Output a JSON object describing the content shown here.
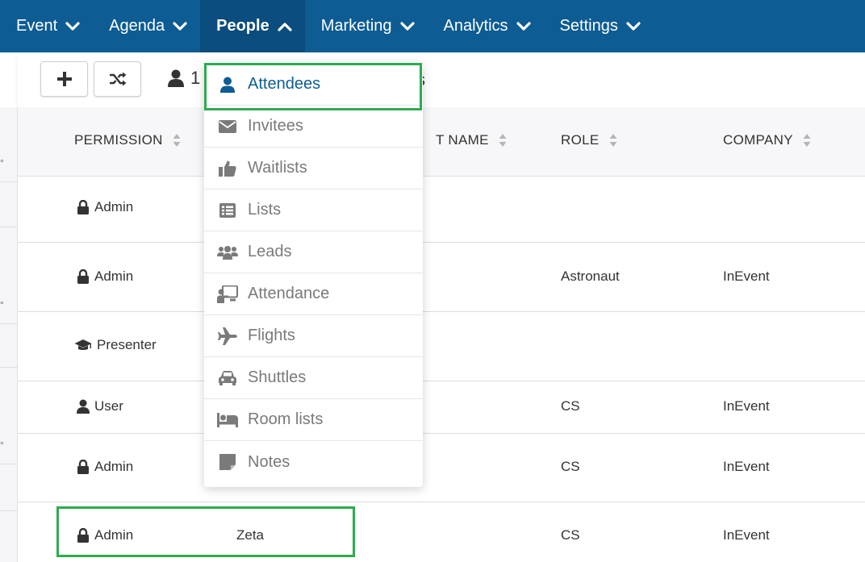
{
  "nav": {
    "items": [
      {
        "label": "Event"
      },
      {
        "label": "Agenda"
      },
      {
        "label": "People"
      },
      {
        "label": "Marketing"
      },
      {
        "label": "Analytics"
      },
      {
        "label": "Settings"
      }
    ],
    "active": "People"
  },
  "toolbar": {
    "count_prefix": "1",
    "count_suffix": "ists"
  },
  "table": {
    "headers": {
      "permission": "PERMISSION",
      "last_name": "T NAME",
      "role": "ROLE",
      "company": "COMPANY"
    },
    "rows": [
      {
        "permission": "Admin",
        "icon": "lock-icon",
        "name": "",
        "role": "",
        "company": ""
      },
      {
        "permission": "Admin",
        "icon": "lock-icon",
        "name": "",
        "role": "Astronaut",
        "company": "InEvent"
      },
      {
        "permission": "Presenter",
        "icon": "graduation-cap-icon",
        "name": "",
        "role": "",
        "company": ""
      },
      {
        "permission": "User",
        "icon": "user-icon",
        "name": "",
        "role": "CS",
        "company": "InEvent"
      },
      {
        "permission": "Admin",
        "icon": "lock-icon",
        "name": "",
        "role": "CS",
        "company": "InEvent"
      },
      {
        "permission": "Admin",
        "icon": "lock-icon",
        "name": "Zeta",
        "role": "CS",
        "company": "InEvent"
      }
    ]
  },
  "dropdown": {
    "items": [
      {
        "label": "Attendees",
        "icon": "user-icon",
        "active": true
      },
      {
        "label": "Invitees",
        "icon": "envelope-icon"
      },
      {
        "label": "Waitlists",
        "icon": "thumbs-up-icon"
      },
      {
        "label": "Lists",
        "icon": "list-icon"
      },
      {
        "label": "Leads",
        "icon": "users-icon"
      },
      {
        "label": "Attendance",
        "icon": "chalkboard-user-icon"
      },
      {
        "label": "Flights",
        "icon": "plane-icon"
      },
      {
        "label": "Shuttles",
        "icon": "car-icon"
      },
      {
        "label": "Room lists",
        "icon": "bed-icon"
      },
      {
        "label": "Notes",
        "icon": "sticky-note-icon"
      }
    ]
  },
  "colors": {
    "nav_bg": "#0d5c93",
    "highlight": "#2dab4f",
    "active_item": "#0d5c93"
  }
}
